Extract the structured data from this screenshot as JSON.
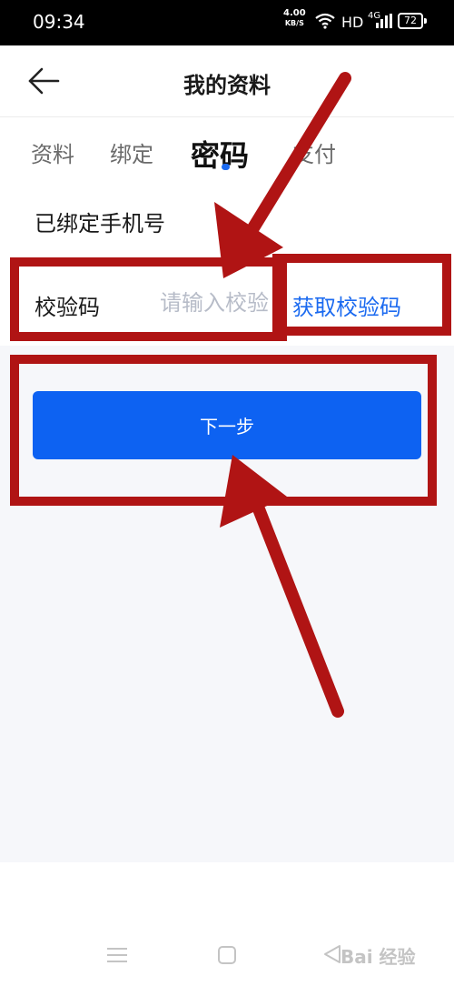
{
  "status_bar": {
    "time": "09:34",
    "net_speed_value": "4.00",
    "net_speed_unit": "KB/S",
    "hd": "HD",
    "signal": "4G",
    "battery": "72"
  },
  "header": {
    "title": "我的资料",
    "back_icon": "arrow-left-icon"
  },
  "tabs": [
    {
      "label": "资料"
    },
    {
      "label": "绑定"
    },
    {
      "label": "密码",
      "active": true
    },
    {
      "label": "支付"
    }
  ],
  "form": {
    "bound_phone_label": "已绑定手机号",
    "code_label": "校验码",
    "code_placeholder": "请输入校验码",
    "code_value": "",
    "get_code_label": "获取校验码",
    "next_button_label": "下一步"
  },
  "annotations": {
    "color": "#b01414"
  },
  "colors": {
    "accent": "#0d62f2",
    "link": "#1b6af0"
  },
  "nav_bar": {
    "icons": [
      "menu-icon",
      "home-square-icon",
      "back-triangle-icon"
    ],
    "watermark": "Bai 经验"
  }
}
